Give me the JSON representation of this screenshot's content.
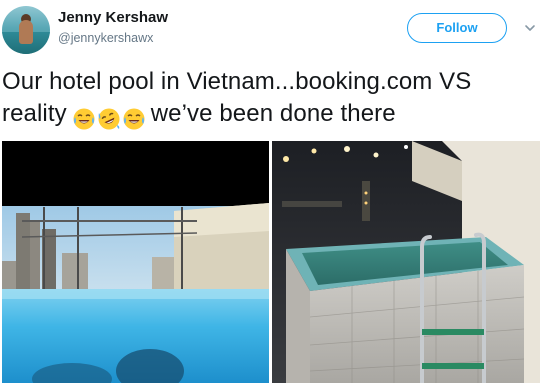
{
  "author": {
    "display_name": "Jenny Kershaw",
    "handle": "@jennykershawx"
  },
  "follow_button": {
    "label": "Follow"
  },
  "tweet": {
    "text_before_emoji": "Our hotel pool in Vietnam...booking.com VS reality",
    "emojis": [
      "face-with-tears-of-joy",
      "rolling-on-the-floor-laughing",
      "face-with-tears-of-joy"
    ],
    "text_after_emoji": "we’ve been done there"
  },
  "media": [
    {
      "name": "booking-photo",
      "description_icon": "rooftop-infinity-pool-image"
    },
    {
      "name": "reality-photo",
      "description_icon": "small-tiled-pool-image"
    }
  ],
  "colors": {
    "accent": "#1da1f2",
    "text": "#14171a",
    "secondary": "#657786"
  },
  "icons": {
    "caret": "chevron-down-icon"
  }
}
